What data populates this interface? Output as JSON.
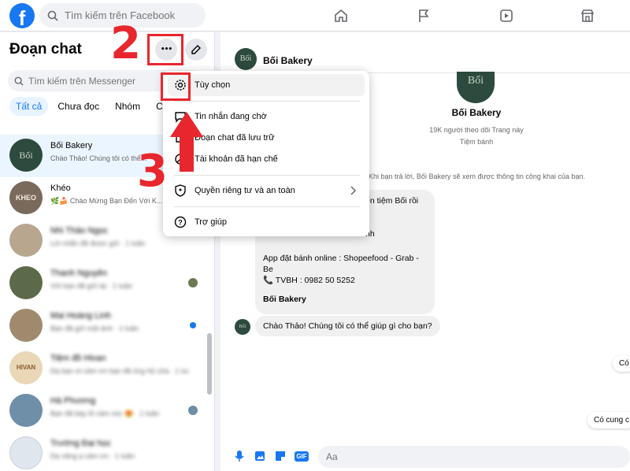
{
  "topbar": {
    "logo_letter": "f",
    "search_placeholder": "Tìm kiếm trên Facebook",
    "nav_icons": [
      "home-icon",
      "flag-icon",
      "video-icon",
      "marketplace-icon"
    ]
  },
  "sidebar": {
    "title": "Đoạn chat",
    "more_label": "•••",
    "search_placeholder": "Tìm kiếm trên Messenger",
    "filters": [
      "Tất cả",
      "Chưa đọc",
      "Nhóm",
      "Cộn"
    ],
    "chats": [
      {
        "name": "Bối Bakery",
        "preview": "Chào Thảo! Chúng tôi có thể...",
        "avatar_text": "Bối",
        "avatar_color": "#2c4a3d",
        "blurred": false,
        "selected": true
      },
      {
        "name": "Khéo",
        "preview": "🌿🍰 Chào Mừng Bạn Đến Với K...",
        "avatar_text": "KHEO",
        "avatar_color": "#7a6a5c",
        "blurred": false,
        "selected": false
      },
      {
        "name": "Nhi Thảo Ngọc",
        "preview": "Lời nhắn đã được gửi · 1 tuần",
        "avatar_text": "",
        "avatar_color": "#b9a68e",
        "blurred": true,
        "selected": false
      },
      {
        "name": "Thanh Nguyễn",
        "preview": "Với bạn đã gửi lại · 1 tuần",
        "avatar_text": "",
        "avatar_color": "#5c6a4a",
        "blurred": true,
        "selected": false
      },
      {
        "name": "Mai Hoàng Linh",
        "preview": "Bạn đã gửi một ảnh · 1 tuần",
        "avatar_text": "",
        "avatar_color": "#a08a6e",
        "blurred": true,
        "selected": false
      },
      {
        "name": "Tiệm đồ Hivan",
        "preview": "Dạ bạn ơi cảm ơn bạn đã ủng hộ cửa · 1 tuần",
        "avatar_text": "HIVAN",
        "avatar_color": "#e9d7b8",
        "blurred": true,
        "selected": false
      },
      {
        "name": "Hà Phương",
        "preview": "Bạn đã bày tỏ cảm xúc 😍 · 1 tuần",
        "avatar_text": "",
        "avatar_color": "#6f8ea8",
        "blurred": true,
        "selected": false
      },
      {
        "name": "Trường Đại học",
        "preview": "Dạ vâng ạ cảm ơn ·  1 tuần",
        "avatar_text": "",
        "avatar_color": "#dfe6ee",
        "blurred": true,
        "selected": false
      }
    ],
    "times": [
      "1 tuần",
      "1 tuần",
      "1 tuần"
    ]
  },
  "menu": {
    "items": [
      {
        "label": "Tùy chọn",
        "icon": "gear-icon"
      },
      {
        "label": "Tin nhắn đang chờ",
        "icon": "chat-bubble-icon"
      },
      {
        "label": "Đoạn chat đã lưu trữ",
        "icon": "archive-icon"
      },
      {
        "label": "Tài khoản đã hạn chế",
        "icon": "restricted-icon"
      },
      {
        "label": "Quyền riêng tư và an toàn",
        "icon": "shield-icon"
      },
      {
        "label": "Trợ giúp",
        "icon": "help-icon"
      }
    ]
  },
  "conversation": {
    "name": "Bối Bakery",
    "avatar_text": "Bối",
    "profile_name": "Bối Bakery",
    "followers": "19K người theo dõi Trang này",
    "category": "Tiệm bánh",
    "notice": "Khi bạn trả lời, Bối Bakery sẽ xem được thông tin công khai của bạn.",
    "bubble_lines": [
      "ến tiệm Bối rồi",
      "nh",
      "App đặt bánh online : Shopeefood - Grab -",
      "Be",
      "📞 TVBH : 0982 50 5252",
      "Bối Bakery"
    ],
    "greeting": "Chào Thảo! Chúng tôi có thể giúp gì cho bạn?",
    "chip_1": "Có",
    "chip_2": "Có cung c"
  },
  "composer": {
    "placeholder": "Aa",
    "gif_label": "GIF"
  },
  "annotations": {
    "step_2": "2",
    "step_3": "3"
  },
  "colors": {
    "brand": "#1877f2",
    "annotation_red": "#e8262d",
    "selected_bg": "#ebf5ff"
  }
}
